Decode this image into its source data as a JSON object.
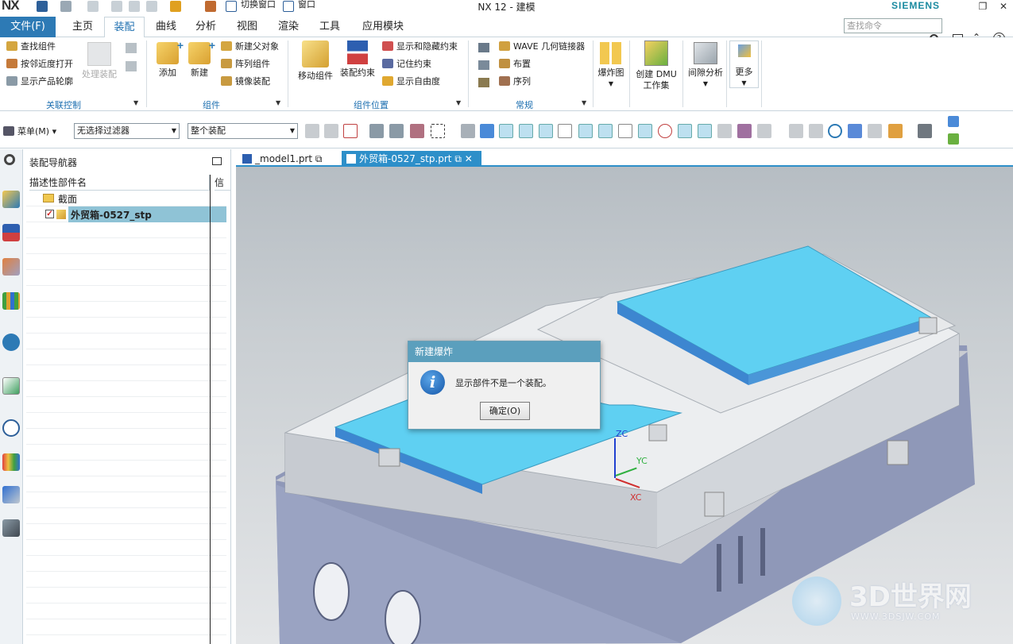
{
  "app": {
    "logo": "NX",
    "title": "NX 12 - 建模",
    "brand": "SIEMENS",
    "quick_access": {
      "switch_window": "切换窗口",
      "window": "窗口"
    }
  },
  "ribbon": {
    "file_tab": "文件(F)",
    "tabs": [
      "主页",
      "装配",
      "曲线",
      "分析",
      "视图",
      "渲染",
      "工具",
      "应用模块"
    ],
    "active_tab": "装配",
    "search_placeholder": "查找命令",
    "groups": {
      "relation": {
        "label": "关联控制",
        "items": [
          "查找组件",
          "按邻近度打开",
          "显示产品轮廓"
        ],
        "disabled": "处理装配"
      },
      "component": {
        "label": "组件",
        "big": [
          "添加",
          "新建"
        ],
        "items": [
          "新建父对象",
          "阵列组件",
          "镜像装配"
        ]
      },
      "position": {
        "label": "组件位置",
        "big": [
          "移动组件",
          "装配约束"
        ],
        "items": [
          "显示和隐藏约束",
          "记住约束",
          "显示自由度"
        ]
      },
      "general": {
        "label": "常规",
        "items": [
          "WAVE 几何链接器",
          "布置",
          "序列"
        ]
      },
      "more": {
        "exploded": "爆炸图",
        "dmu_line1": "创建 DMU",
        "dmu_line2": "工作集",
        "clearance": "间隙分析",
        "more": "更多"
      }
    }
  },
  "toolbar": {
    "menu": "菜单(M)",
    "filter": "无选择过滤器",
    "scope": "整个装配"
  },
  "navigator": {
    "title": "装配导航器",
    "columns": [
      "描述性部件名",
      "信息"
    ],
    "rows": [
      {
        "label": "截面",
        "checked": false
      },
      {
        "label": "外贸箱-0527_stp",
        "checked": true,
        "selected": true
      }
    ]
  },
  "documents": {
    "tabs": [
      {
        "label": "_model1.prt",
        "active": false
      },
      {
        "label": "外贸箱-0527_stp.prt",
        "active": true
      }
    ]
  },
  "dialog": {
    "title": "新建爆炸",
    "message": "显示部件不是一个装配。",
    "ok": "确定(O)"
  },
  "triad": {
    "zc": "ZC",
    "yc": "YC",
    "xc": "XC"
  },
  "watermark": {
    "main": "3D世界网",
    "sub": "WWW.3DSJW.COM"
  },
  "colors": {
    "accent": "#2d7ab5",
    "lid": "#5fd0f2",
    "body": "#9aa3c2"
  }
}
